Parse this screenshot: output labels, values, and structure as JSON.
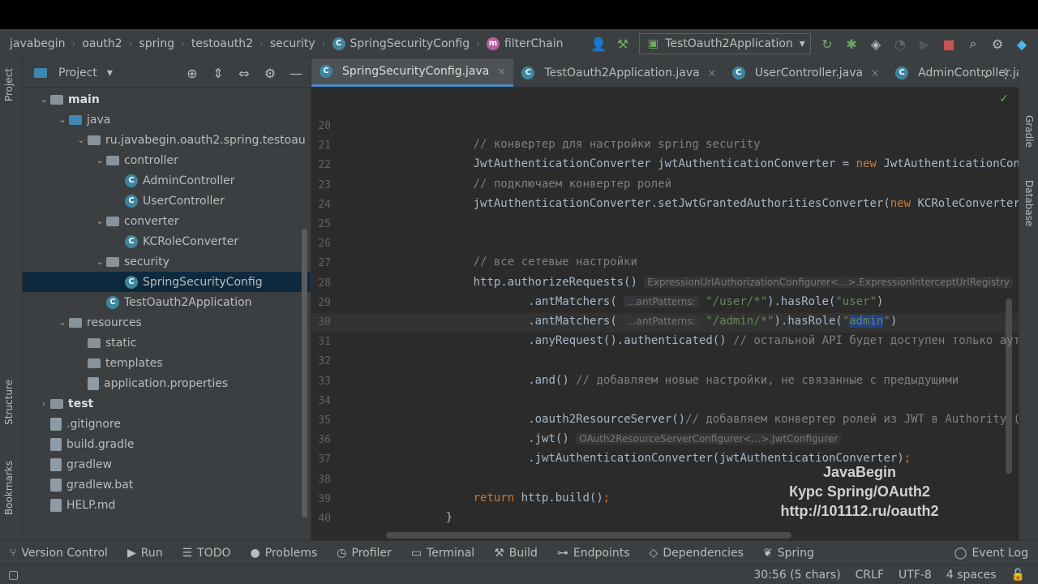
{
  "breadcrumbs": [
    "javabegin",
    "oauth2",
    "spring",
    "testoauth2",
    "security",
    "SpringSecurityConfig",
    "filterChain"
  ],
  "run_config": "TestOauth2Application",
  "project_panel": {
    "title": "Project",
    "tree": [
      {
        "label": "main",
        "depth": 2,
        "kind": "folder",
        "open": true,
        "bold": true
      },
      {
        "label": "java",
        "depth": 3,
        "kind": "folder-blue",
        "open": true
      },
      {
        "label": "ru.javabegin.oauth2.spring.testoau",
        "depth": 4,
        "kind": "folder",
        "open": true
      },
      {
        "label": "controller",
        "depth": 5,
        "kind": "folder",
        "open": true
      },
      {
        "label": "AdminController",
        "depth": 6,
        "kind": "class"
      },
      {
        "label": "UserController",
        "depth": 6,
        "kind": "class"
      },
      {
        "label": "converter",
        "depth": 5,
        "kind": "folder",
        "open": true
      },
      {
        "label": "KCRoleConverter",
        "depth": 6,
        "kind": "class"
      },
      {
        "label": "security",
        "depth": 5,
        "kind": "folder",
        "open": true
      },
      {
        "label": "SpringSecurityConfig",
        "depth": 6,
        "kind": "class",
        "selected": true
      },
      {
        "label": "TestOauth2Application",
        "depth": 5,
        "kind": "class"
      },
      {
        "label": "resources",
        "depth": 3,
        "kind": "folder",
        "open": true
      },
      {
        "label": "static",
        "depth": 4,
        "kind": "folder"
      },
      {
        "label": "templates",
        "depth": 4,
        "kind": "folder"
      },
      {
        "label": "application.properties",
        "depth": 4,
        "kind": "file"
      },
      {
        "label": "test",
        "depth": 2,
        "kind": "folder",
        "open": false,
        "bold": true
      },
      {
        "label": ".gitignore",
        "depth": 2,
        "kind": "file"
      },
      {
        "label": "build.gradle",
        "depth": 2,
        "kind": "file"
      },
      {
        "label": "gradlew",
        "depth": 2,
        "kind": "file"
      },
      {
        "label": "gradlew.bat",
        "depth": 2,
        "kind": "file"
      },
      {
        "label": "HELP.md",
        "depth": 2,
        "kind": "file"
      }
    ]
  },
  "tabs": [
    {
      "label": "SpringSecurityConfig.java",
      "active": true
    },
    {
      "label": "TestOauth2Application.java",
      "active": false
    },
    {
      "label": "UserController.java",
      "active": false
    },
    {
      "label": "AdminController.java",
      "active": false
    }
  ],
  "side_tabs": {
    "left_top": "Project",
    "left_mid": "Structure",
    "left_bottom": "Bookmarks",
    "right_top": "Gradle",
    "right_mid": "Database"
  },
  "code_lines": [
    {
      "n": "20",
      "indent": 0,
      "parts": []
    },
    {
      "n": "21",
      "indent": 8,
      "parts": [
        [
          "cm",
          "// конвертер для настройки spring security"
        ]
      ]
    },
    {
      "n": "22",
      "indent": 8,
      "parts": [
        [
          "",
          "JwtAuthenticationConverter jwtAuthenticationConverter = "
        ],
        [
          "kw",
          "new"
        ],
        [
          "",
          " JwtAuthenticationConve"
        ]
      ]
    },
    {
      "n": "23",
      "indent": 8,
      "parts": [
        [
          "cm",
          "// подключаем конвертер ролей"
        ]
      ]
    },
    {
      "n": "24",
      "indent": 8,
      "parts": [
        [
          "",
          "jwtAuthenticationConverter.setJwtGrantedAuthoritiesConverter("
        ],
        [
          "kw",
          "new"
        ],
        [
          "",
          " KCRoleConverter()"
        ]
      ]
    },
    {
      "n": "25",
      "indent": 0,
      "parts": []
    },
    {
      "n": "26",
      "indent": 0,
      "parts": []
    },
    {
      "n": "27",
      "indent": 8,
      "parts": [
        [
          "cm",
          "// все сетевые настройки"
        ]
      ]
    },
    {
      "n": "28",
      "indent": 8,
      "parts": [
        [
          "",
          "http.authorizeRequests() "
        ],
        [
          "hint",
          "ExpressionUrlAuthorizationConfigurer<...>.ExpressionInterceptUrlRegistry"
        ]
      ]
    },
    {
      "n": "29",
      "indent": 16,
      "parts": [
        [
          "",
          ".antMatchers( "
        ],
        [
          "hint",
          "...antPatterns:"
        ],
        [
          "",
          " "
        ],
        [
          "st",
          "\"/user/*\""
        ],
        [
          "",
          ").hasRole("
        ],
        [
          "st",
          "\"user\""
        ],
        [
          "",
          ")"
        ]
      ]
    },
    {
      "n": "30",
      "indent": 16,
      "parts": [
        [
          "",
          ".antMatchers( "
        ],
        [
          "hint",
          "...antPatterns:"
        ],
        [
          "",
          " "
        ],
        [
          "st",
          "\"/admin/*\""
        ],
        [
          "",
          ").hasRole("
        ],
        [
          "st",
          "\""
        ],
        [
          "hl",
          "admin"
        ],
        [
          "st",
          "\""
        ],
        [
          "",
          ")"
        ]
      ]
    },
    {
      "n": "31",
      "indent": 16,
      "parts": [
        [
          "",
          ".anyRequest().authenticated() "
        ],
        [
          "cm",
          "// остальной API будет доступен только аутен"
        ]
      ]
    },
    {
      "n": "32",
      "indent": 0,
      "parts": []
    },
    {
      "n": "33",
      "indent": 16,
      "parts": [
        [
          "",
          ".and() "
        ],
        [
          "cm",
          "// добавляем новые настройки, не связанные с предыдущими"
        ]
      ]
    },
    {
      "n": "34",
      "indent": 0,
      "parts": []
    },
    {
      "n": "35",
      "indent": 16,
      "parts": [
        [
          "",
          ".oauth2ResourceServer()"
        ],
        [
          "cm",
          "// добавляем конвертер ролей из JWT в Authority (Ro"
        ]
      ]
    },
    {
      "n": "36",
      "indent": 16,
      "parts": [
        [
          "",
          ".jwt() "
        ],
        [
          "hint",
          "OAuth2ResourceServerConfigurer<...>.JwtConfigurer"
        ]
      ]
    },
    {
      "n": "37",
      "indent": 16,
      "parts": [
        [
          "",
          ".jwtAuthenticationConverter(jwtAuthenticationConverter)"
        ],
        [
          "kw",
          ";"
        ]
      ]
    },
    {
      "n": "38",
      "indent": 0,
      "parts": []
    },
    {
      "n": "39",
      "indent": 8,
      "parts": [
        [
          "kw",
          "return"
        ],
        [
          "",
          " http.build()"
        ],
        [
          "kw",
          ";"
        ]
      ]
    },
    {
      "n": "40",
      "indent": 4,
      "parts": [
        [
          "",
          "}"
        ]
      ]
    }
  ],
  "current_line": "30",
  "watermark": [
    "JavaBegin",
    "Курс Spring/OAuth2",
    "http://101112.ru/oauth2"
  ],
  "bottom_tools": [
    "Version Control",
    "Run",
    "TODO",
    "Problems",
    "Profiler",
    "Terminal",
    "Build",
    "Endpoints",
    "Dependencies",
    "Spring"
  ],
  "event_log": "Event Log",
  "status": {
    "position": "30:56 (5 chars)",
    "line_sep": "CRLF",
    "encoding": "UTF-8",
    "indent": "4 spaces"
  }
}
